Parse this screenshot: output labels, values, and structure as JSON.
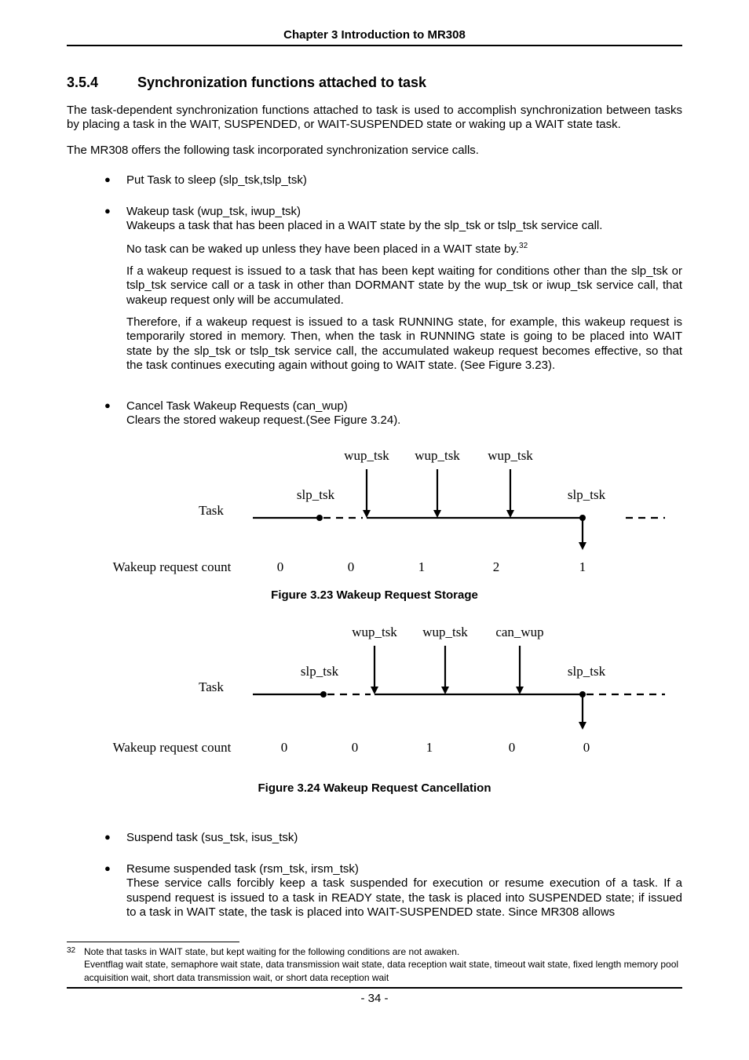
{
  "chapter_header": "Chapter 3 Introduction to MR308",
  "section": {
    "number": "3.5.4",
    "title": "Synchronization functions attached to task"
  },
  "paragraphs": {
    "p1": "The task-dependent synchronization functions attached to task is used to accomplish synchronization between tasks by placing a task in the WAIT, SUSPENDED, or WAIT-SUSPENDED state or waking up a WAIT state task.",
    "p2": "The MR308 offers the following task incorporated synchronization service calls."
  },
  "bullets": {
    "b1": "Put Task to sleep (slp_tsk,tslp_tsk)",
    "b2_title": "Wakeup task (wup_tsk, iwup_tsk)",
    "b2_l1": "Wakeups a task that has been placed in a WAIT state by the slp_tsk or tslp_tsk service call.",
    "b2_l2a": "No task can be waked up unless they have been placed in a WAIT state by.",
    "b2_sup": "32",
    "b2_l3": "If a wakeup request is issued to a task that has been kept waiting for conditions other than the slp_tsk or tslp_tsk service call or a task in other than DORMANT state   by the wup_tsk or iwup_tsk service call, that wakeup request only will be accumulated.",
    "b2_l4": "Therefore, if a wakeup request is issued to a task RUNNING state, for example, this wakeup request is temporarily stored in memory. Then, when the task in RUNNING state is going to be placed into WAIT state by the slp_tsk or tslp_tsk service call, the accumulated wakeup request becomes effective, so that the task continues executing again without going to WAIT state.    (See Figure 3.23).",
    "b3_title": "Cancel Task Wakeup Requests (can_wup)",
    "b3_l1": "Clears the stored wakeup request.(See Figure 3.24).",
    "b4": "Suspend task (sus_tsk, isus_tsk)",
    "b5_title": "Resume suspended task (rsm_tsk, irsm_tsk)",
    "b5_l1": "These service calls forcibly keep a task suspended for execution or resume execution of a task. If a suspend request is issued to a task in READY state, the task is placed into SUSPENDED state; if issued to a task in WAIT state, the task is placed into WAIT-SUSPENDED state. Since MR308 allows"
  },
  "chart_data": [
    {
      "type": "timing-diagram",
      "id": "fig_3_23",
      "title": "Figure 3.23 Wakeup Request Storage",
      "row_label": "Task",
      "count_label": "Wakeup request count",
      "top_labels": [
        "wup_tsk",
        "wup_tsk",
        "wup_tsk"
      ],
      "slp_labels": [
        "slp_tsk",
        "slp_tsk"
      ],
      "counts": [
        "0",
        "0",
        "1",
        "2",
        "1"
      ]
    },
    {
      "type": "timing-diagram",
      "id": "fig_3_24",
      "title": "Figure 3.24 Wakeup Request Cancellation",
      "row_label": "Task",
      "count_label": "Wakeup request count",
      "top_labels": [
        "wup_tsk",
        "wup_tsk",
        "can_wup"
      ],
      "slp_labels": [
        "slp_tsk",
        "slp_tsk"
      ],
      "counts": [
        "0",
        "0",
        "1",
        "0",
        "0"
      ]
    }
  ],
  "footnote": {
    "num": "32",
    "line1": "Note that tasks in WAIT state, but kept waiting for the following conditions are not awaken.",
    "line2": "Eventflag wait state, semaphore wait state, data transmission wait state, data reception wait state, timeout wait state, fixed length memory pool acquisition wait, short data transmission wait, or short data reception wait"
  },
  "page_number": "- 34 -"
}
